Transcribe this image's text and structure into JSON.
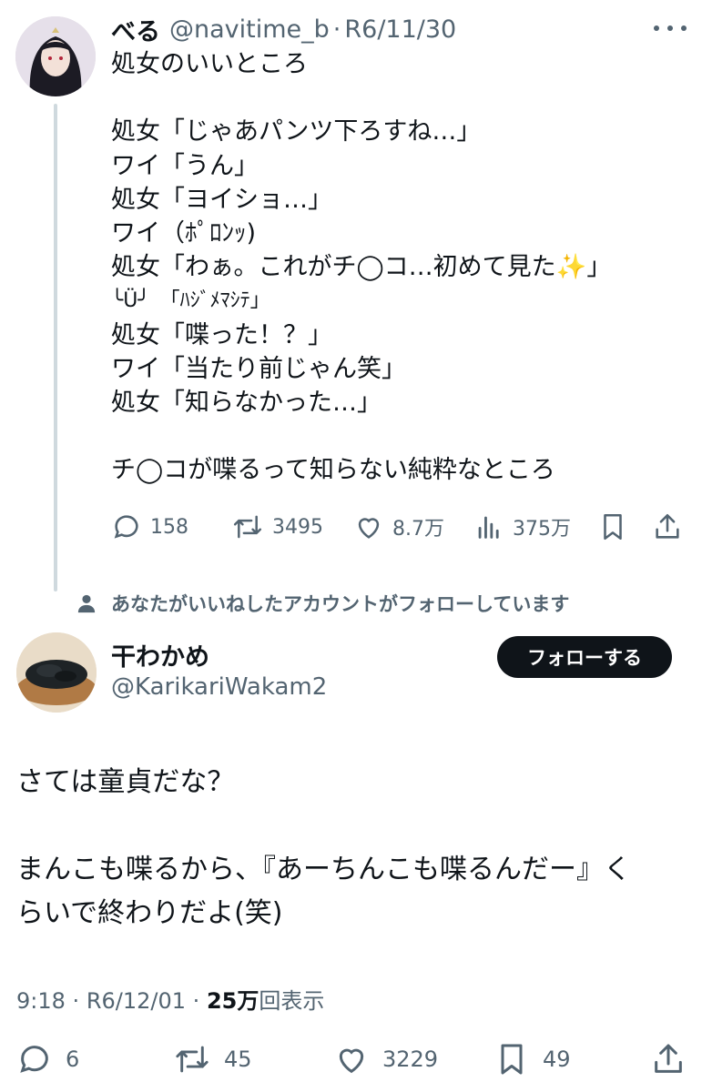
{
  "parent_tweet": {
    "display_name": "べる",
    "handle": "@navitime_b",
    "separator": "·",
    "date": "R6/11/30",
    "lines": [
      "処女のいいところ",
      "",
      "処女「じゃあパンツ下ろすね…」",
      "ワイ「うん」",
      "処女「ヨイショ…」",
      "ワイ（ﾎﾟﾛﾝｯ)",
      "処女「わぁ。これがチ◯コ…初めて見た",
      "╰Ü╯　「ﾊｼﾞﾒﾏｼﾃ」",
      "処女「喋った！？」",
      "ワイ「当たり前じゃん笑」",
      "処女「知らなかった…」",
      "",
      "チ◯コが喋るって知らない純粋なところ"
    ],
    "line7_suffix": "」",
    "sparkle_emoji": "✨",
    "actions": {
      "replies": "158",
      "retweets": "3495",
      "likes": "8.7万",
      "views": "375万"
    }
  },
  "social_context": "あなたがいいねしたアカウントがフォローしています",
  "main_tweet": {
    "display_name": "干わかめ",
    "handle": "@KarikariWakam2",
    "follow_label": "フォローする",
    "paragraphs": [
      "さては童貞だな？",
      "",
      "まんこも喋るから、『あーちんこも喋るんだー』く",
      "らいで終わりだよ(笑)"
    ],
    "time": "9:18",
    "sep": "·",
    "date": "R6/12/01",
    "views_count": "25万",
    "views_label": "回表示",
    "actions": {
      "replies": "6",
      "retweets": "45",
      "likes": "3229",
      "bookmarks": "49"
    }
  },
  "icons": [
    "more-icon",
    "reply-icon",
    "retweet-icon",
    "like-icon",
    "views-icon",
    "bookmark-icon",
    "share-icon",
    "person-icon"
  ],
  "colors": {
    "text": "#0f1419",
    "secondary": "#536471",
    "thread_line": "#cfd9de",
    "button_bg": "#0f1419"
  }
}
